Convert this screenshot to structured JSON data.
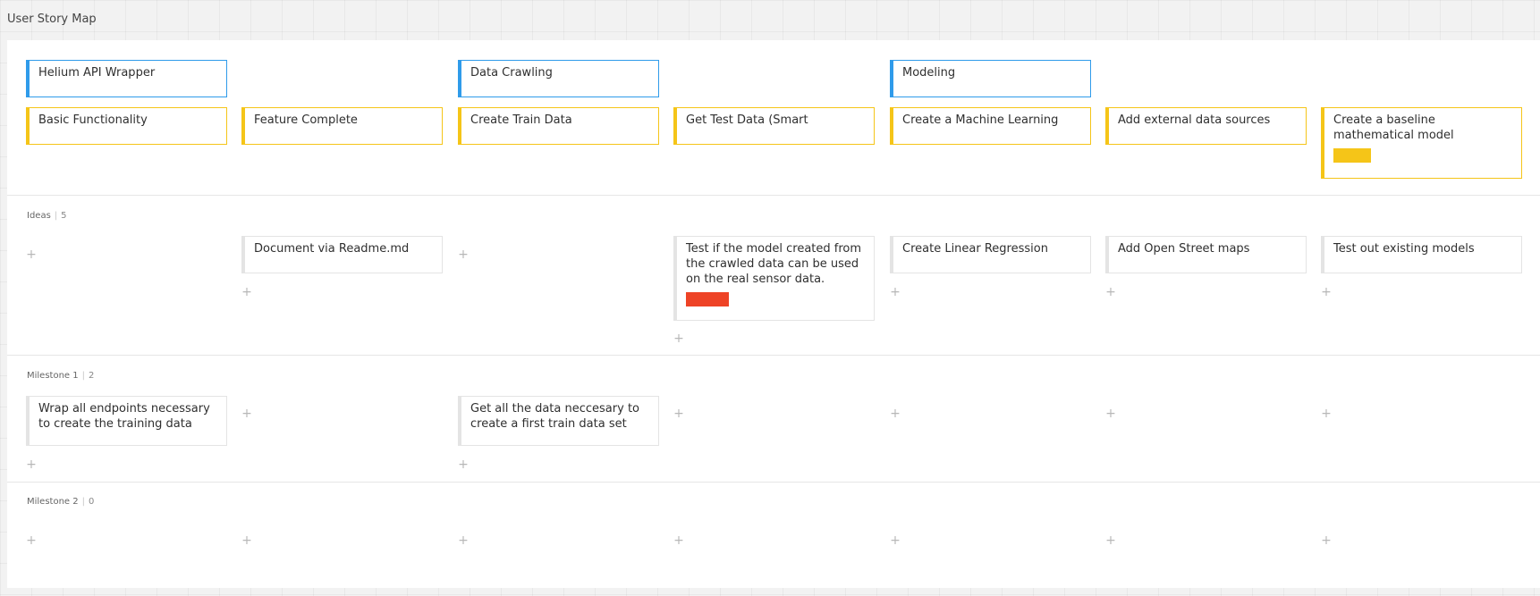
{
  "frame": {
    "title": "User Story Map"
  },
  "epics": [
    {
      "label": "Helium API Wrapper"
    },
    {
      "label": "Data Crawling"
    },
    {
      "label": "Modeling"
    }
  ],
  "features": [
    {
      "label": "Basic Functionality"
    },
    {
      "label": "Feature Complete"
    },
    {
      "label": "Create Train Data"
    },
    {
      "label": "Get Test Data (Smart"
    },
    {
      "label": "Create a Machine Learning"
    },
    {
      "label": "Add external data sources"
    },
    {
      "label": "Create a baseline mathematical model",
      "tag_color": "#f5c518"
    }
  ],
  "lanes": [
    {
      "name": "Ideas",
      "count": "5",
      "cards": [
        {
          "text": "Document via Readme.md"
        },
        {
          "text": "Test if the model created from the crawled data can be used on the real sensor data.",
          "tag_color": "#ee4326"
        },
        {
          "text": "Create Linear Regression"
        },
        {
          "text": "Add Open Street maps"
        },
        {
          "text": "Test out existing models"
        }
      ]
    },
    {
      "name": "Milestone 1",
      "count": "2",
      "cards": [
        {
          "text": "Wrap all endpoints necessary to create the training data"
        },
        {
          "text": "Get all the data neccesary to create a first train data set"
        }
      ]
    },
    {
      "name": "Milestone 2",
      "count": "0",
      "cards": []
    }
  ],
  "add_symbol": "+",
  "colors": {
    "epic": "#2f9bea",
    "feature": "#f5c518",
    "red_tag": "#ee4326",
    "yellow_tag": "#f5c518"
  }
}
